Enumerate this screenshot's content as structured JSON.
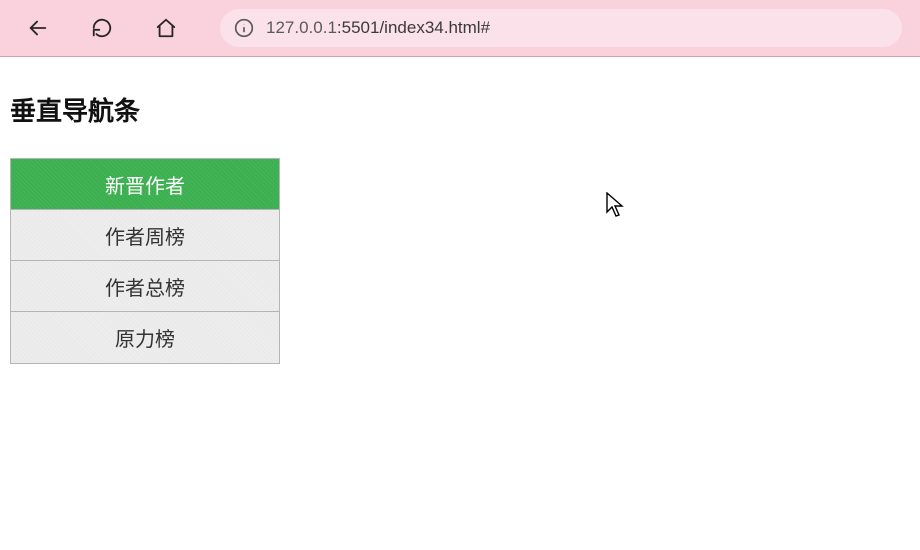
{
  "toolbar": {
    "url_host": "127.0.0.1",
    "url_port": ":5501",
    "url_path": "/index34.html#"
  },
  "page": {
    "heading": "垂直导航条"
  },
  "nav": {
    "items": [
      {
        "label": "新晋作者",
        "active": true
      },
      {
        "label": "作者周榜",
        "active": false
      },
      {
        "label": "作者总榜",
        "active": false
      },
      {
        "label": "原力榜",
        "active": false
      }
    ]
  }
}
